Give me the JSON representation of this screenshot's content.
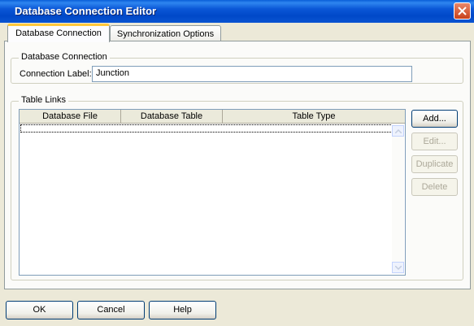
{
  "window": {
    "title": "Database Connection Editor"
  },
  "tabs": [
    {
      "label": "Database Connection",
      "active": true
    },
    {
      "label": "Synchronization Options",
      "active": false
    }
  ],
  "db_group": {
    "label": "Database Connection",
    "connection_label": "Connection Label:",
    "connection_value": "Junction"
  },
  "table_links": {
    "label": "Table Links",
    "columns": [
      "Database File",
      "Database Table",
      "Table Type"
    ],
    "rows": []
  },
  "side_buttons": {
    "add": "Add...",
    "edit": "Edit...",
    "duplicate": "Duplicate",
    "delete": "Delete"
  },
  "footer": {
    "ok": "OK",
    "cancel": "Cancel",
    "help": "Help"
  },
  "icons": {
    "close": "close-icon",
    "scroll_up": "chevron-up-icon",
    "scroll_down": "chevron-down-icon"
  }
}
